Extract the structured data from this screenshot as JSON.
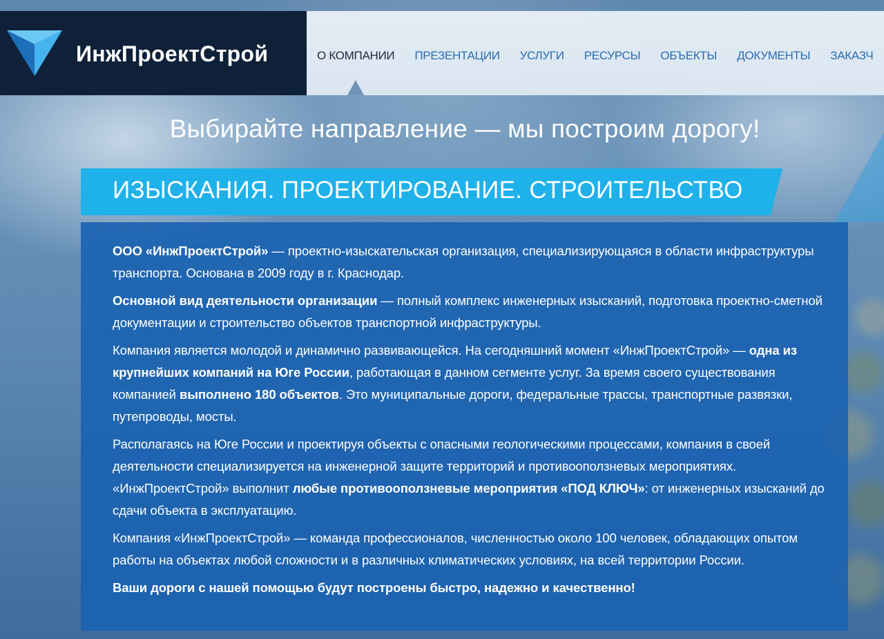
{
  "header": {
    "brand_name": "ИнжПроектСтрой",
    "logo_icon": "triangle-logo-icon",
    "nav": [
      {
        "label": "О КОМПАНИИ",
        "active": true
      },
      {
        "label": "ПРЕЗЕНТАЦИИ",
        "active": false
      },
      {
        "label": "УСЛУГИ",
        "active": false
      },
      {
        "label": "РЕСУРСЫ",
        "active": false
      },
      {
        "label": "ОБЪЕКТЫ",
        "active": false
      },
      {
        "label": "ДОКУМЕНТЫ",
        "active": false
      },
      {
        "label": "ЗАКАЗЧ",
        "active": false
      }
    ]
  },
  "hero": {
    "slogan": "Выбирайте направление — мы построим дорогу!",
    "section_title": "ИЗЫСКАНИЯ. ПРОЕКТИРОВАНИЕ. СТРОИТЕЛЬСТВО"
  },
  "about": {
    "p1": {
      "bold": "ООО «ИнжПроектСтрой»",
      "text": " — проектно-изыскательская организация, специализирующаяся в области инфраструктуры транспорта. Основана в 2009 году в г. Краснодар."
    },
    "p2": {
      "bold": "Основной вид деятельности организации",
      "text": " — полный комплекс инженерных изысканий, подготовка проектно-сметной документации и строительство объектов транспортной инфраструктуры."
    },
    "p3": {
      "text1": "Компания является молодой и динамично развивающейся. На сегодняшний момент «ИнжПроектСтрой» — ",
      "bold1": "одна из крупнейших компаний на Юге России",
      "text2": ", работающая в данном сегменте услуг. За время своего существования компанией ",
      "bold2": "выполнено 180 объектов",
      "text3": ". Это муниципальные дороги, федеральные трассы, транспортные развязки, путепроводы, мосты."
    },
    "p4": {
      "text1": "Располагаясь на Юге России и проектируя объекты с опасными геологическими процессами, компания в своей деятельности специализируется на инженерной защите территорий и противооползневых мероприятиях. «ИнжПроектСтрой» выполнит ",
      "bold1": "любые противооползневые мероприятия «ПОД КЛЮЧ»",
      "text2": ": от инженерных изысканий до сдачи объекта в эксплуатацию."
    },
    "p5": {
      "text": "Компания «ИнжПроектСтрой» — команда профессионалов, численностью около 100 человек, обладающих опытом работы на объектах любой сложности и в различных климатических условиях, на всей территории России."
    },
    "p6": {
      "bold": "Ваши дороги с нашей помощью будут построены быстро, надежно и качественно!"
    }
  },
  "colors": {
    "brand_dark": "#0f2138",
    "nav_link": "#2a6cb0",
    "nav_active": "#1d2a3a",
    "accent_cyan": "#1fb1ea",
    "panel_blue": "#1a62b0"
  }
}
